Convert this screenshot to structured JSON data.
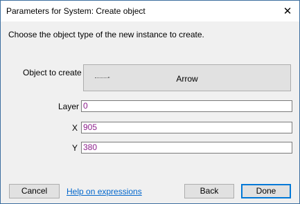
{
  "window": {
    "title": "Parameters for System: Create object",
    "close_glyph": "✕"
  },
  "instruction": "Choose the object type of the new instance to create.",
  "object_to_create": {
    "label": "Object to create",
    "value": "Arrow"
  },
  "fields": {
    "layer": {
      "label": "Layer",
      "value": "0"
    },
    "x": {
      "label": "X",
      "value": "905"
    },
    "y": {
      "label": "Y",
      "value": "380"
    }
  },
  "footer": {
    "cancel_label": "Cancel",
    "help_link": "Help on expressions",
    "back_label": "Back",
    "done_label": "Done"
  },
  "colors": {
    "accent": "#0078d7",
    "value_text": "#8b1d8b",
    "link": "#0066cc"
  }
}
